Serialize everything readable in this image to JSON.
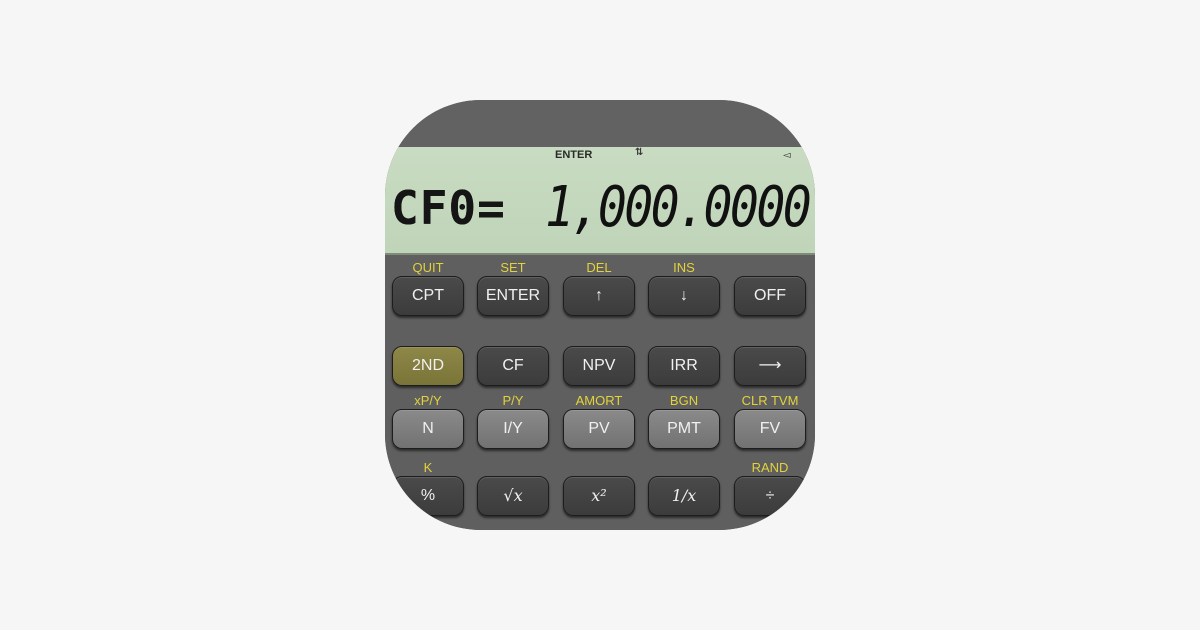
{
  "display": {
    "annunciators": {
      "enter": "ENTER",
      "arrows": "⇅",
      "indicator": "◅"
    },
    "label": "CF0=",
    "value": "1,000.0000"
  },
  "colors": {
    "background": "#f6f6f6",
    "body": "#5e5e5e",
    "lcd": "#c9dcc3",
    "secondary_label": "#e3d23a",
    "second_key": "#857f42"
  },
  "rows": [
    [
      {
        "secondary": "QUIT",
        "label": "CPT"
      },
      {
        "secondary": "SET",
        "label": "ENTER"
      },
      {
        "secondary": "DEL",
        "label": "↑"
      },
      {
        "secondary": "INS",
        "label": "↓"
      },
      {
        "secondary": "",
        "label": "OFF"
      }
    ],
    [
      {
        "secondary": "",
        "label": "2ND"
      },
      {
        "secondary": "",
        "label": "CF"
      },
      {
        "secondary": "",
        "label": "NPV"
      },
      {
        "secondary": "",
        "label": "IRR"
      },
      {
        "secondary": "",
        "label": "⟶"
      }
    ],
    [
      {
        "secondary": "xP/Y",
        "label": "N"
      },
      {
        "secondary": "P/Y",
        "label": "I/Y"
      },
      {
        "secondary": "AMORT",
        "label": "PV"
      },
      {
        "secondary": "BGN",
        "label": "PMT"
      },
      {
        "secondary": "CLR TVM",
        "label": "FV"
      }
    ],
    [
      {
        "secondary": "K",
        "label": "%"
      },
      {
        "secondary": "",
        "label": "√x"
      },
      {
        "secondary": "",
        "label": "x²"
      },
      {
        "secondary": "",
        "label": "1/x"
      },
      {
        "secondary": "RAND",
        "label": "÷"
      }
    ]
  ]
}
